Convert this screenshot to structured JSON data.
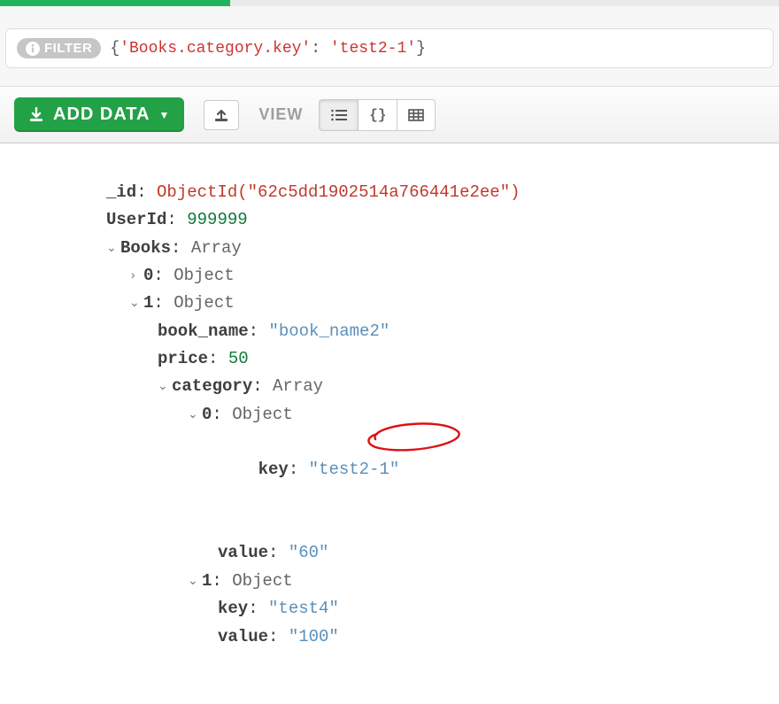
{
  "filter": {
    "label": "FILTER",
    "query_prefix": "{",
    "query_key": "'Books.category.key'",
    "query_sep": ": ",
    "query_val": "'test2-1'",
    "query_suffix": "}"
  },
  "toolbar": {
    "add_data_label": "ADD DATA",
    "view_label": "VIEW",
    "braces": "{}"
  },
  "doc": {
    "id_field": "_id",
    "id_value": "ObjectId(\"62c5dd1902514a766441e2ee\")",
    "userid_field": "UserId",
    "userid_value": "999999",
    "books_field": "Books",
    "books_type": "Array",
    "book0_idx": "0",
    "book0_type": "Object",
    "book1_idx": "1",
    "book1_type": "Object",
    "bookname_field": "book_name",
    "bookname_value": "\"book_name2\"",
    "price_field": "price",
    "price_value": "50",
    "category_field": "category",
    "category_type": "Array",
    "cat0_idx": "0",
    "cat0_type": "Object",
    "cat0_key_field": "key",
    "cat0_key_value": "\"test2-1\"",
    "cat0_val_field": "value",
    "cat0_val_value": "\"60\"",
    "cat1_idx": "1",
    "cat1_type": "Object",
    "cat1_key_field": "key",
    "cat1_key_value": "\"test4\"",
    "cat1_val_field": "value",
    "cat1_val_value": "\"100\""
  }
}
